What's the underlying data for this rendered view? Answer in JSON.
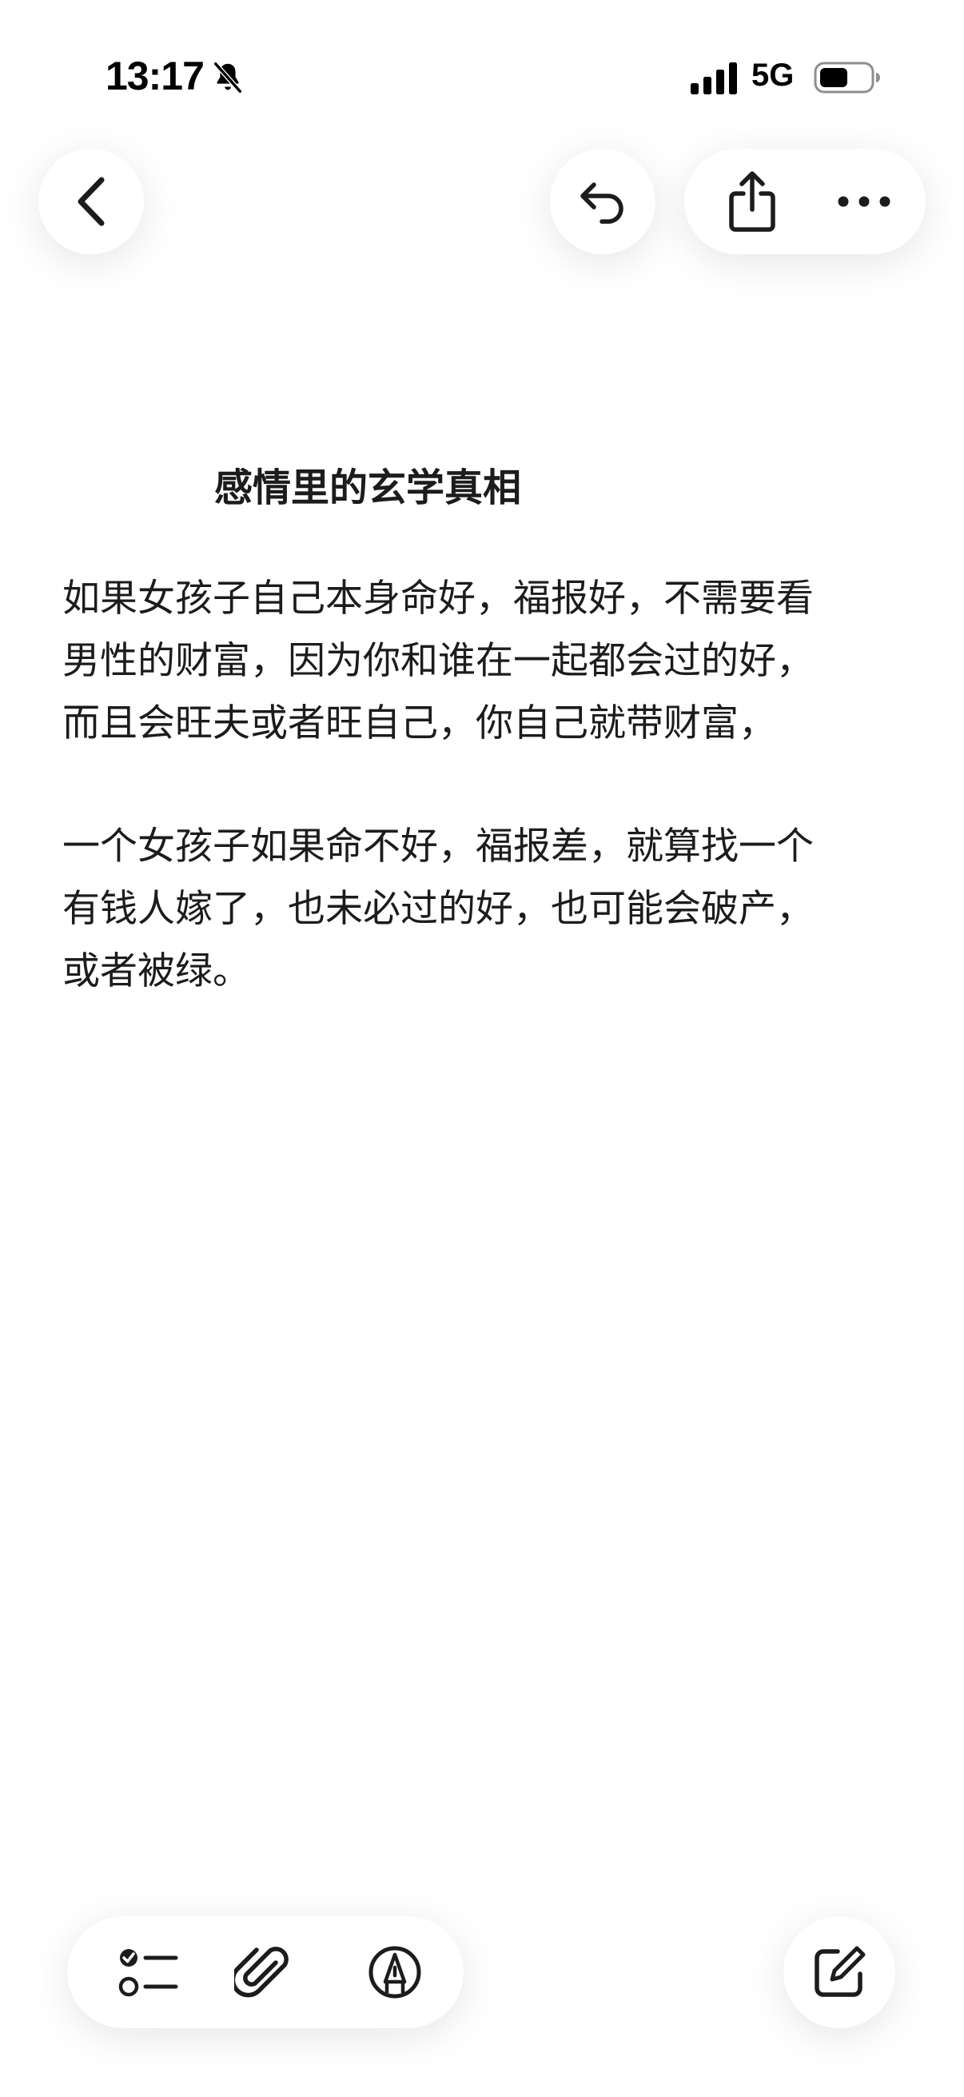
{
  "status_bar": {
    "time": "13:17",
    "network": "5G",
    "icons": [
      "mute-bell-icon",
      "cellular-signal-icon",
      "battery-icon"
    ]
  },
  "toolbar_top": {
    "icons": [
      "chevron-left-icon",
      "undo-icon",
      "share-icon",
      "ellipsis-icon"
    ]
  },
  "note": {
    "title": "感情里的玄学真相",
    "paragraphs": [
      "如果女孩子自己本身命好，福报好，不需要看\n男性的财富，因为你和谁在一起都会过的好，\n而且会旺夫或者旺自己，你自己就带财富，",
      "一个女孩子如果命不好，福报差，就算找一个\n有钱人嫁了，也未必过的好，也可能会破产，\n或者被绿。"
    ]
  },
  "toolbar_bottom": {
    "icons": [
      "checklist-icon",
      "paperclip-icon",
      "markup-pen-icon",
      "compose-icon"
    ]
  },
  "colors": {
    "background": "#ffffff",
    "text": "#1c1c1e",
    "icon": "#1c1c1e"
  }
}
